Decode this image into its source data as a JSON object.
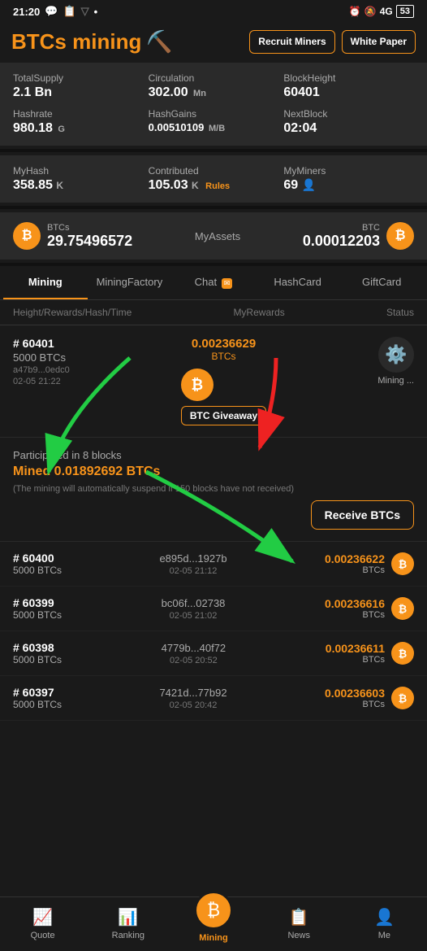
{
  "status": {
    "time": "21:20",
    "battery": "53"
  },
  "header": {
    "logo": "BTCs mining",
    "recruit_btn": "Recruit Miners",
    "white_paper_btn": "White Paper"
  },
  "stats": {
    "total_supply_label": "TotalSupply",
    "total_supply_value": "2.1 Bn",
    "circulation_label": "Circulation",
    "circulation_value": "302.00",
    "circulation_unit": "Mn",
    "block_height_label": "BlockHeight",
    "block_height_value": "60401",
    "hashrate_label": "Hashrate",
    "hashrate_value": "980.18",
    "hashrate_unit": "G",
    "hash_gains_label": "HashGains",
    "hash_gains_value": "0.00510109",
    "hash_gains_unit": "M/B",
    "next_block_label": "NextBlock",
    "next_block_value": "02:04"
  },
  "my_stats": {
    "my_hash_label": "MyHash",
    "my_hash_value": "358.85",
    "my_hash_unit": "K",
    "contributed_label": "Contributed",
    "contributed_value": "105.03",
    "contributed_unit": "K",
    "rules_label": "Rules",
    "my_miners_label": "MyMiners",
    "my_miners_value": "69"
  },
  "assets": {
    "btcs_label": "BTCs",
    "btcs_value": "29.75496572",
    "my_assets_label": "MyAssets",
    "btc_label": "BTC",
    "btc_value": "0.00012203"
  },
  "tabs": [
    {
      "id": "mining",
      "label": "Mining",
      "active": true,
      "badge": ""
    },
    {
      "id": "mining-factory",
      "label": "MiningFactory",
      "active": false,
      "badge": ""
    },
    {
      "id": "chat",
      "label": "Chat",
      "active": false,
      "badge": "✉"
    },
    {
      "id": "hashcard",
      "label": "HashCard",
      "active": false,
      "badge": ""
    },
    {
      "id": "giftcard",
      "label": "GiftCard",
      "active": false,
      "badge": ""
    }
  ],
  "table_header": {
    "col1": "Height/Rewards/Hash/Time",
    "col2": "MyRewards",
    "col3": "Status"
  },
  "current_block": {
    "number": "# 60401",
    "amount": "5000 BTCs",
    "hash": "a47b9...0edc0",
    "time": "02-05 21:22",
    "center_value": "0.00236629",
    "center_unit": "BTCs",
    "giveaway_label": "BTC Giveaway",
    "status_label": "Mining ..."
  },
  "participated": {
    "title": "Participated in 8 blocks",
    "mined": "Mined 0.01892692 BTCs",
    "note": "(The mining will automatically suspend if 150 blocks have not received)",
    "receive_btn": "Receive BTCs"
  },
  "blocks": [
    {
      "number": "# 60400",
      "amount": "5000 BTCs",
      "hash": "e895d...1927b",
      "time": "02-05 21:12",
      "reward": "0.00236622",
      "reward_unit": "BTCs"
    },
    {
      "number": "# 60399",
      "amount": "5000 BTCs",
      "hash": "bc06f...02738",
      "time": "02-05 21:02",
      "reward": "0.00236616",
      "reward_unit": "BTCs"
    },
    {
      "number": "# 60398",
      "amount": "5000 BTCs",
      "hash": "4779b...40f72",
      "time": "02-05 20:52",
      "reward": "0.00236611",
      "reward_unit": "BTCs"
    },
    {
      "number": "# 60397",
      "amount": "5000 BTCs",
      "hash": "7421d...77b92",
      "time": "02-05 20:42",
      "reward": "0.00236603",
      "reward_unit": "BTCs"
    }
  ],
  "bottom_nav": [
    {
      "id": "quote",
      "label": "Quote",
      "icon": "📈"
    },
    {
      "id": "ranking",
      "label": "Ranking",
      "icon": "📊"
    },
    {
      "id": "mining",
      "label": "Mining",
      "icon": "🪙",
      "center": true
    },
    {
      "id": "news",
      "label": "News",
      "icon": "📋"
    },
    {
      "id": "me",
      "label": "Me",
      "icon": "👤"
    }
  ]
}
